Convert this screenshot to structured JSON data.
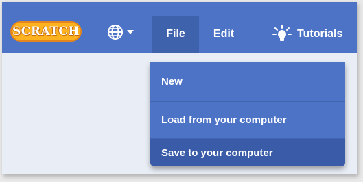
{
  "app": {
    "logo_text": "SCRATCH"
  },
  "menubar": {
    "language_icon": "globe-icon",
    "language_caret_icon": "caret-down-icon",
    "file_label": "File",
    "edit_label": "Edit",
    "tutorials_icon": "lightbulb-icon",
    "tutorials_label": "Tutorials"
  },
  "file_menu": {
    "items": [
      {
        "label": "New"
      },
      {
        "label": "Load from your computer"
      },
      {
        "label": "Save to your computer",
        "hovered": true
      }
    ]
  },
  "colors": {
    "menubar": "#4c73c6",
    "menu_active": "#3f62ad",
    "item_hover": "#3a5ca8",
    "logo": "#ffb21f",
    "page_background": "#e9eef6"
  }
}
